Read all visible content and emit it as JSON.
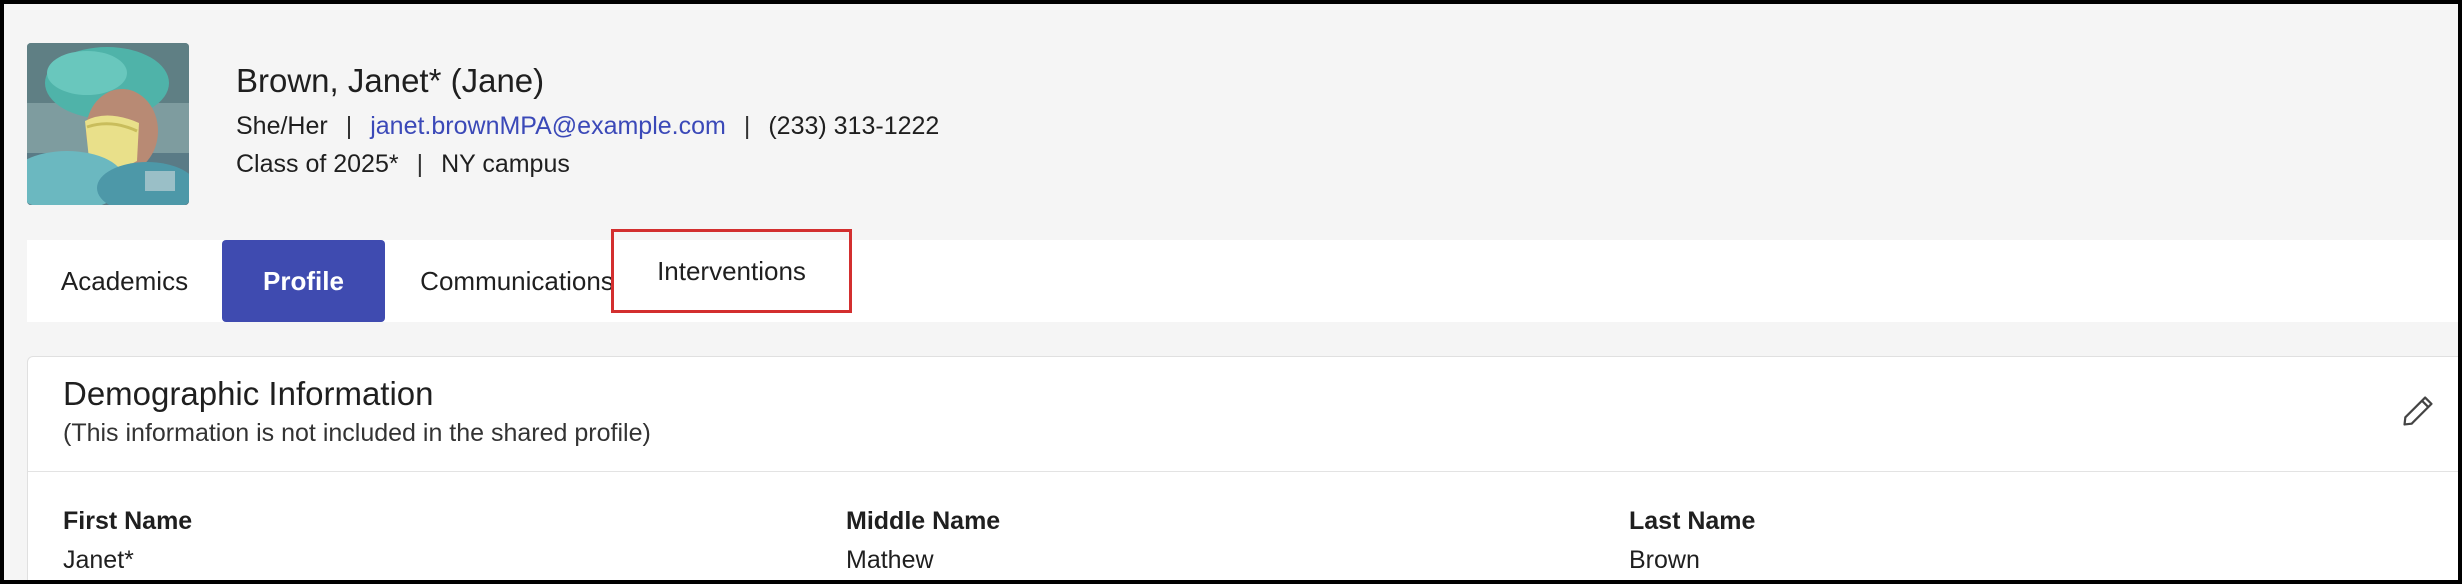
{
  "student": {
    "name": "Brown, Janet*  (Jane)",
    "pronouns": "She/Her",
    "email": "janet.brownMPA@example.com",
    "phone": "(233) 313-1222",
    "class_of": "Class of 2025*",
    "campus": "NY campus",
    "separator": "|"
  },
  "tabs": [
    {
      "label": "Academics",
      "active": false
    },
    {
      "label": "Profile",
      "active": true
    },
    {
      "label": "Communications",
      "active": false
    },
    {
      "label": "Interventions",
      "active": false,
      "highlighted": true
    }
  ],
  "demographics": {
    "title": "Demographic Information",
    "subtitle": "(This information is not included in the shared profile)",
    "edit_icon": "pencil-icon",
    "fields": [
      {
        "label": "First Name",
        "value": "Janet*"
      },
      {
        "label": "Middle Name",
        "value": "Mathew"
      },
      {
        "label": "Last Name",
        "value": "Brown"
      }
    ]
  },
  "colors": {
    "accent": "#3f4bb0",
    "link": "#3b49b8",
    "highlight_border": "#d32f2f",
    "background": "#f5f5f5"
  }
}
